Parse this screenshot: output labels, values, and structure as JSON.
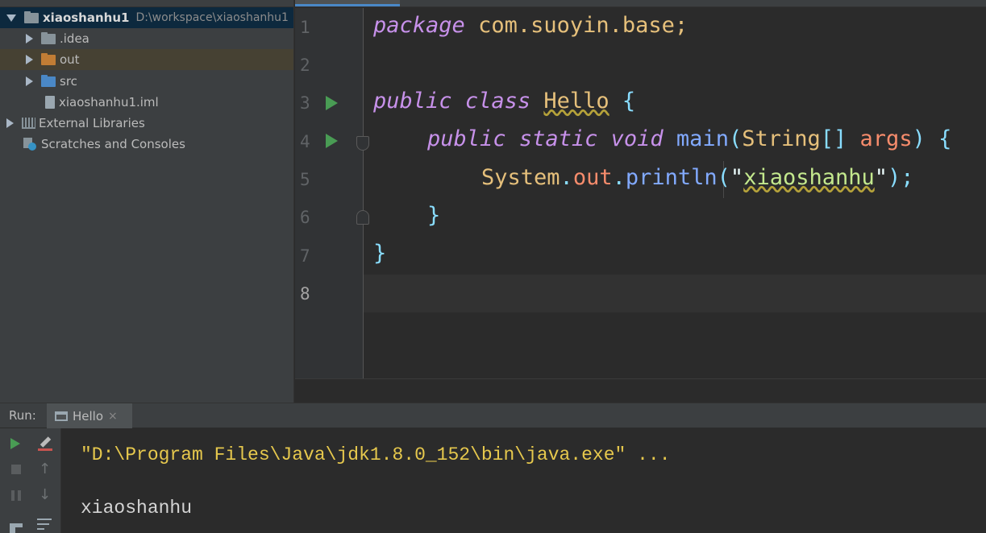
{
  "project_tree": {
    "root": {
      "name": "xiaoshanhu1",
      "path": "D:\\workspace\\xiaoshanhu1"
    },
    "items": [
      {
        "label": ".idea",
        "type": "folder"
      },
      {
        "label": "out",
        "type": "folder"
      },
      {
        "label": "src",
        "type": "folder"
      },
      {
        "label": "xiaoshanhu1.iml",
        "type": "file"
      },
      {
        "label": "External Libraries",
        "type": "libraries"
      },
      {
        "label": "Scratches and Consoles",
        "type": "scratches"
      }
    ]
  },
  "editor": {
    "line_numbers": [
      "1",
      "2",
      "3",
      "4",
      "5",
      "6",
      "7",
      "8"
    ],
    "code": {
      "l1_kw": "package",
      "l1_rest": "com.suoyin.base;",
      "l3_kw1": "public",
      "l3_kw2": "class",
      "l3_name": "Hello",
      "l3_brace": "{",
      "l4_kw1": "public",
      "l4_kw2": "static",
      "l4_kw3": "void",
      "l4_fn": "main",
      "l4_open": "(",
      "l4_type": "String",
      "l4_arr": "[]",
      "l4_arg": "args",
      "l4_close": ")",
      "l4_brace": "{",
      "l5_sys": "System",
      "l5_dot1": ".",
      "l5_out": "out",
      "l5_dot2": ".",
      "l5_fn": "println",
      "l5_open": "(",
      "l5_q1": "\"",
      "l5_str": "xiaoshanhu",
      "l5_q2": "\"",
      "l5_end": ");",
      "l6_brace": "}",
      "l7_brace": "}"
    }
  },
  "run": {
    "label": "Run:",
    "tab_label": "Hello",
    "tab_close": "×",
    "console_lines": [
      "\"D:\\Program Files\\Java\\jdk1.8.0_152\\bin\\java.exe\" ...",
      "xiaoshanhu"
    ]
  },
  "colors": {
    "folder_blue": "#87939a",
    "folder_out": "#c17d35",
    "folder_src": "#4a88c7",
    "run_green": "#499c54",
    "console_cmd": "#e6c84d",
    "console_text": "#d4d4d4"
  }
}
